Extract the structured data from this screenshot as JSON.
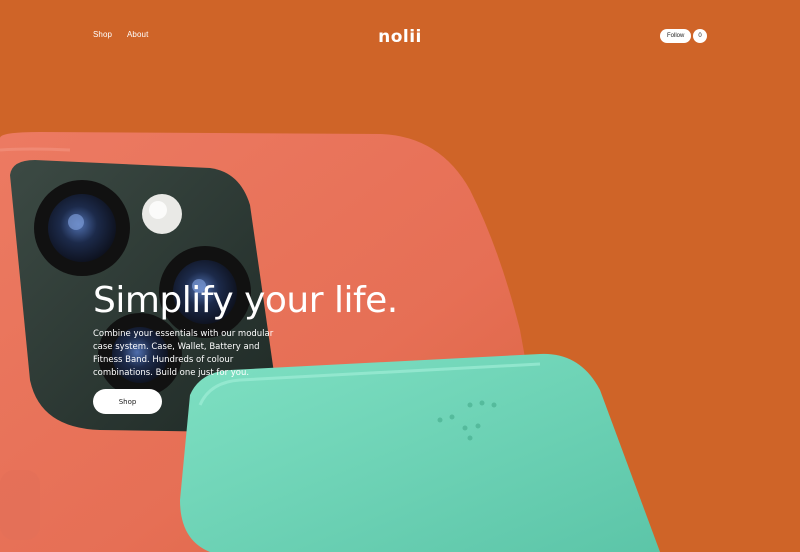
{
  "header": {
    "nav_shop": "Shop",
    "nav_about": "About",
    "logo": "nolii",
    "follow_label": "Follow",
    "cart_count": "0"
  },
  "hero": {
    "headline": "Simplify your life.",
    "subtext": "Combine your essentials with our modular case system. Case, Wallet, Battery and Fitness Band. Hundreds of colour combinations. Build one just for you.",
    "cta_label": "Shop",
    "image": "coral-phone-case-with-mint-wallet"
  },
  "colors": {
    "background": "#cf6428",
    "phone_case": "#e8715a",
    "wallet": "#6fd3b7",
    "button": "#ffffff"
  }
}
